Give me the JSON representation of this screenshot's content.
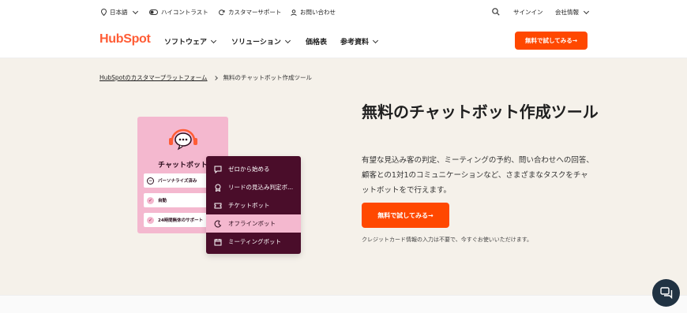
{
  "utility": {
    "language": "日本語",
    "contrast": "ハイコントラスト",
    "support": "カスタマーサポート",
    "contact": "お問い合わせ",
    "signin": "サインイン",
    "company": "会社情報"
  },
  "nav": {
    "logo": "HubSpot",
    "items": [
      "ソフトウェア",
      "ソリューション",
      "価格表",
      "参考資料"
    ],
    "cta": "無料で試してみる→"
  },
  "breadcrumb": {
    "parent": "HubSpotのカスタマープラットフォーム",
    "current": "無料のチャットボット作成ツール"
  },
  "hero": {
    "title": "無料のチャットボット作成ツール",
    "description": "有望な見込み客の判定、ミーティングの予約、問い合わせへの回答、顧客との1対1のコミュニケーションなど、さまざまなタスクをチャットボットをで行えます。",
    "cta": "無料で試してみる→",
    "note": "クレジットカード情報の入力は不要で、今すぐお使いいただけます。"
  },
  "illustration": {
    "card_title": "チャットボット",
    "options": [
      "パーソナライズ済み",
      "自動",
      "24時間無休のサポート"
    ],
    "menu": [
      "ゼロから始める",
      "リードの見込み判定ボ...",
      "チケットボット",
      "オフラインボット",
      "ミーティングボット"
    ],
    "selected_index": 3
  },
  "colors": {
    "accent": "#ff4800",
    "brand": "#ff5c35",
    "menu_bg": "#4a0d2a",
    "pink": "#f4b8cf",
    "hero_bg": "#f5f1ea"
  }
}
